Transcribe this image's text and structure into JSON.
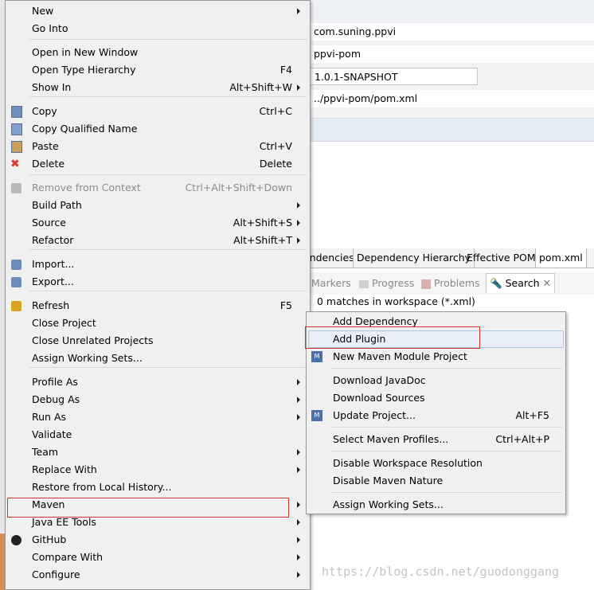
{
  "editor": {
    "fields": [
      "com.suning.ppvi",
      "ppvi-pom",
      "1.0.1-SNAPSHOT",
      "../ppvi-pom/pom.xml"
    ],
    "tabs": [
      "endencies",
      "Dependency Hierarchy",
      "Effective POM",
      "pom.xml"
    ],
    "view_tabs": [
      "Markers",
      "Progress",
      "Problems",
      "Search"
    ],
    "search_result": "0 matches in workspace (*.xml)"
  },
  "context_menu": {
    "items": [
      {
        "label": "New",
        "shortcut": "",
        "submenu": true
      },
      {
        "label": "Go Into",
        "shortcut": ""
      },
      {
        "label": "Open in New Window",
        "shortcut": ""
      },
      {
        "label": "Open Type Hierarchy",
        "shortcut": "F4"
      },
      {
        "label": "Show In",
        "shortcut": "Alt+Shift+W",
        "submenu": true
      },
      {
        "label": "Copy",
        "shortcut": "Ctrl+C",
        "icon": "copy-icon"
      },
      {
        "label": "Copy Qualified Name",
        "shortcut": "",
        "icon": "copy-qualified-icon"
      },
      {
        "label": "Paste",
        "shortcut": "Ctrl+V",
        "icon": "paste-icon"
      },
      {
        "label": "Delete",
        "shortcut": "Delete",
        "icon": "delete-icon"
      },
      {
        "label": "Remove from Context",
        "shortcut": "Ctrl+Alt+Shift+Down",
        "disabled": true
      },
      {
        "label": "Build Path",
        "shortcut": "",
        "submenu": true
      },
      {
        "label": "Source",
        "shortcut": "Alt+Shift+S",
        "submenu": true
      },
      {
        "label": "Refactor",
        "shortcut": "Alt+Shift+T",
        "submenu": true
      },
      {
        "label": "Import...",
        "shortcut": ""
      },
      {
        "label": "Export...",
        "shortcut": ""
      },
      {
        "label": "Refresh",
        "shortcut": "F5"
      },
      {
        "label": "Close Project",
        "shortcut": ""
      },
      {
        "label": "Close Unrelated Projects",
        "shortcut": ""
      },
      {
        "label": "Assign Working Sets...",
        "shortcut": ""
      },
      {
        "label": "Profile As",
        "shortcut": "",
        "submenu": true
      },
      {
        "label": "Debug As",
        "shortcut": "",
        "submenu": true
      },
      {
        "label": "Run As",
        "shortcut": "",
        "submenu": true
      },
      {
        "label": "Validate",
        "shortcut": ""
      },
      {
        "label": "Team",
        "shortcut": "",
        "submenu": true
      },
      {
        "label": "Replace With",
        "shortcut": "",
        "submenu": true
      },
      {
        "label": "Restore from Local History...",
        "shortcut": ""
      },
      {
        "label": "Maven",
        "shortcut": "",
        "submenu": true
      },
      {
        "label": "Java EE Tools",
        "shortcut": "",
        "submenu": true
      },
      {
        "label": "GitHub",
        "shortcut": "",
        "submenu": true
      },
      {
        "label": "Compare With",
        "shortcut": "",
        "submenu": true
      },
      {
        "label": "Configure",
        "shortcut": "",
        "submenu": true
      }
    ]
  },
  "maven_menu": {
    "items": [
      {
        "label": "Add Dependency",
        "shortcut": ""
      },
      {
        "label": "Add Plugin",
        "shortcut": ""
      },
      {
        "label": "New Maven Module Project",
        "shortcut": ""
      },
      {
        "label": "Download JavaDoc",
        "shortcut": ""
      },
      {
        "label": "Download Sources",
        "shortcut": ""
      },
      {
        "label": "Update Project...",
        "shortcut": "Alt+F5"
      },
      {
        "label": "Select Maven Profiles...",
        "shortcut": "Ctrl+Alt+P"
      },
      {
        "label": "Disable Workspace Resolution",
        "shortcut": ""
      },
      {
        "label": "Disable Maven Nature",
        "shortcut": ""
      },
      {
        "label": "Assign Working Sets...",
        "shortcut": ""
      }
    ]
  },
  "watermark": "https://blog.csdn.net/guodonggang",
  "colors": {
    "highlight": "#d32f2f",
    "menu_bg": "#f0f0f0"
  }
}
